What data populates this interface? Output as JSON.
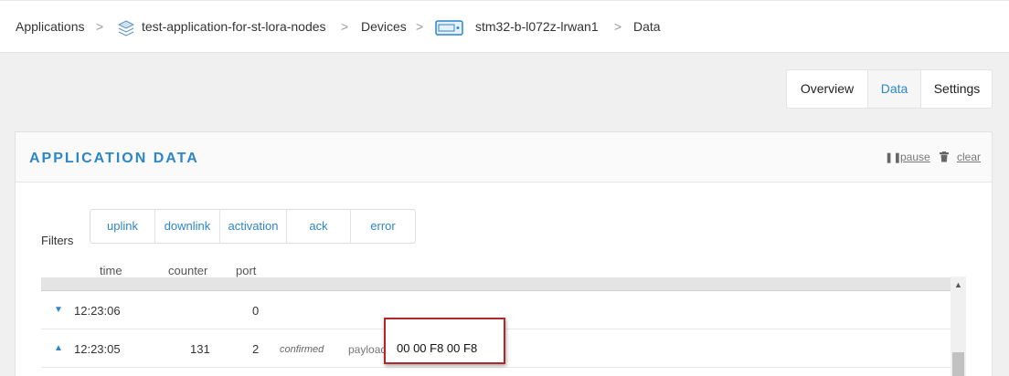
{
  "breadcrumb": {
    "applications": "Applications",
    "application": "test-application-for-st-lora-nodes",
    "devices": "Devices",
    "device": "stm32-b-l072z-lrwan1",
    "current": "Data",
    "separator": ">"
  },
  "tabs": [
    {
      "label": "Overview",
      "active": false
    },
    {
      "label": "Data",
      "active": true
    },
    {
      "label": "Settings",
      "active": false
    }
  ],
  "panel": {
    "title": "APPLICATION DATA",
    "pause_label": "pause",
    "clear_label": "clear",
    "pause_icon": "pause-icon",
    "clear_icon": "trash-icon"
  },
  "filters": {
    "label": "Filters",
    "options": [
      "uplink",
      "downlink",
      "activation",
      "ack",
      "error"
    ]
  },
  "columns": {
    "time": "time",
    "counter": "counter",
    "port": "port"
  },
  "rows": [
    {
      "direction": "down",
      "time": "12:23:06",
      "counter": "",
      "port": "0",
      "confirmed": "",
      "payload_label": "",
      "payload": ""
    },
    {
      "direction": "up",
      "time": "12:23:05",
      "counter": "131",
      "port": "2",
      "confirmed": "confirmed",
      "payload_label": "payload:",
      "payload": "00 00 F8 00 F8"
    }
  ],
  "colors": {
    "accent": "#2d86c8",
    "highlight_border": "#b0282a"
  }
}
